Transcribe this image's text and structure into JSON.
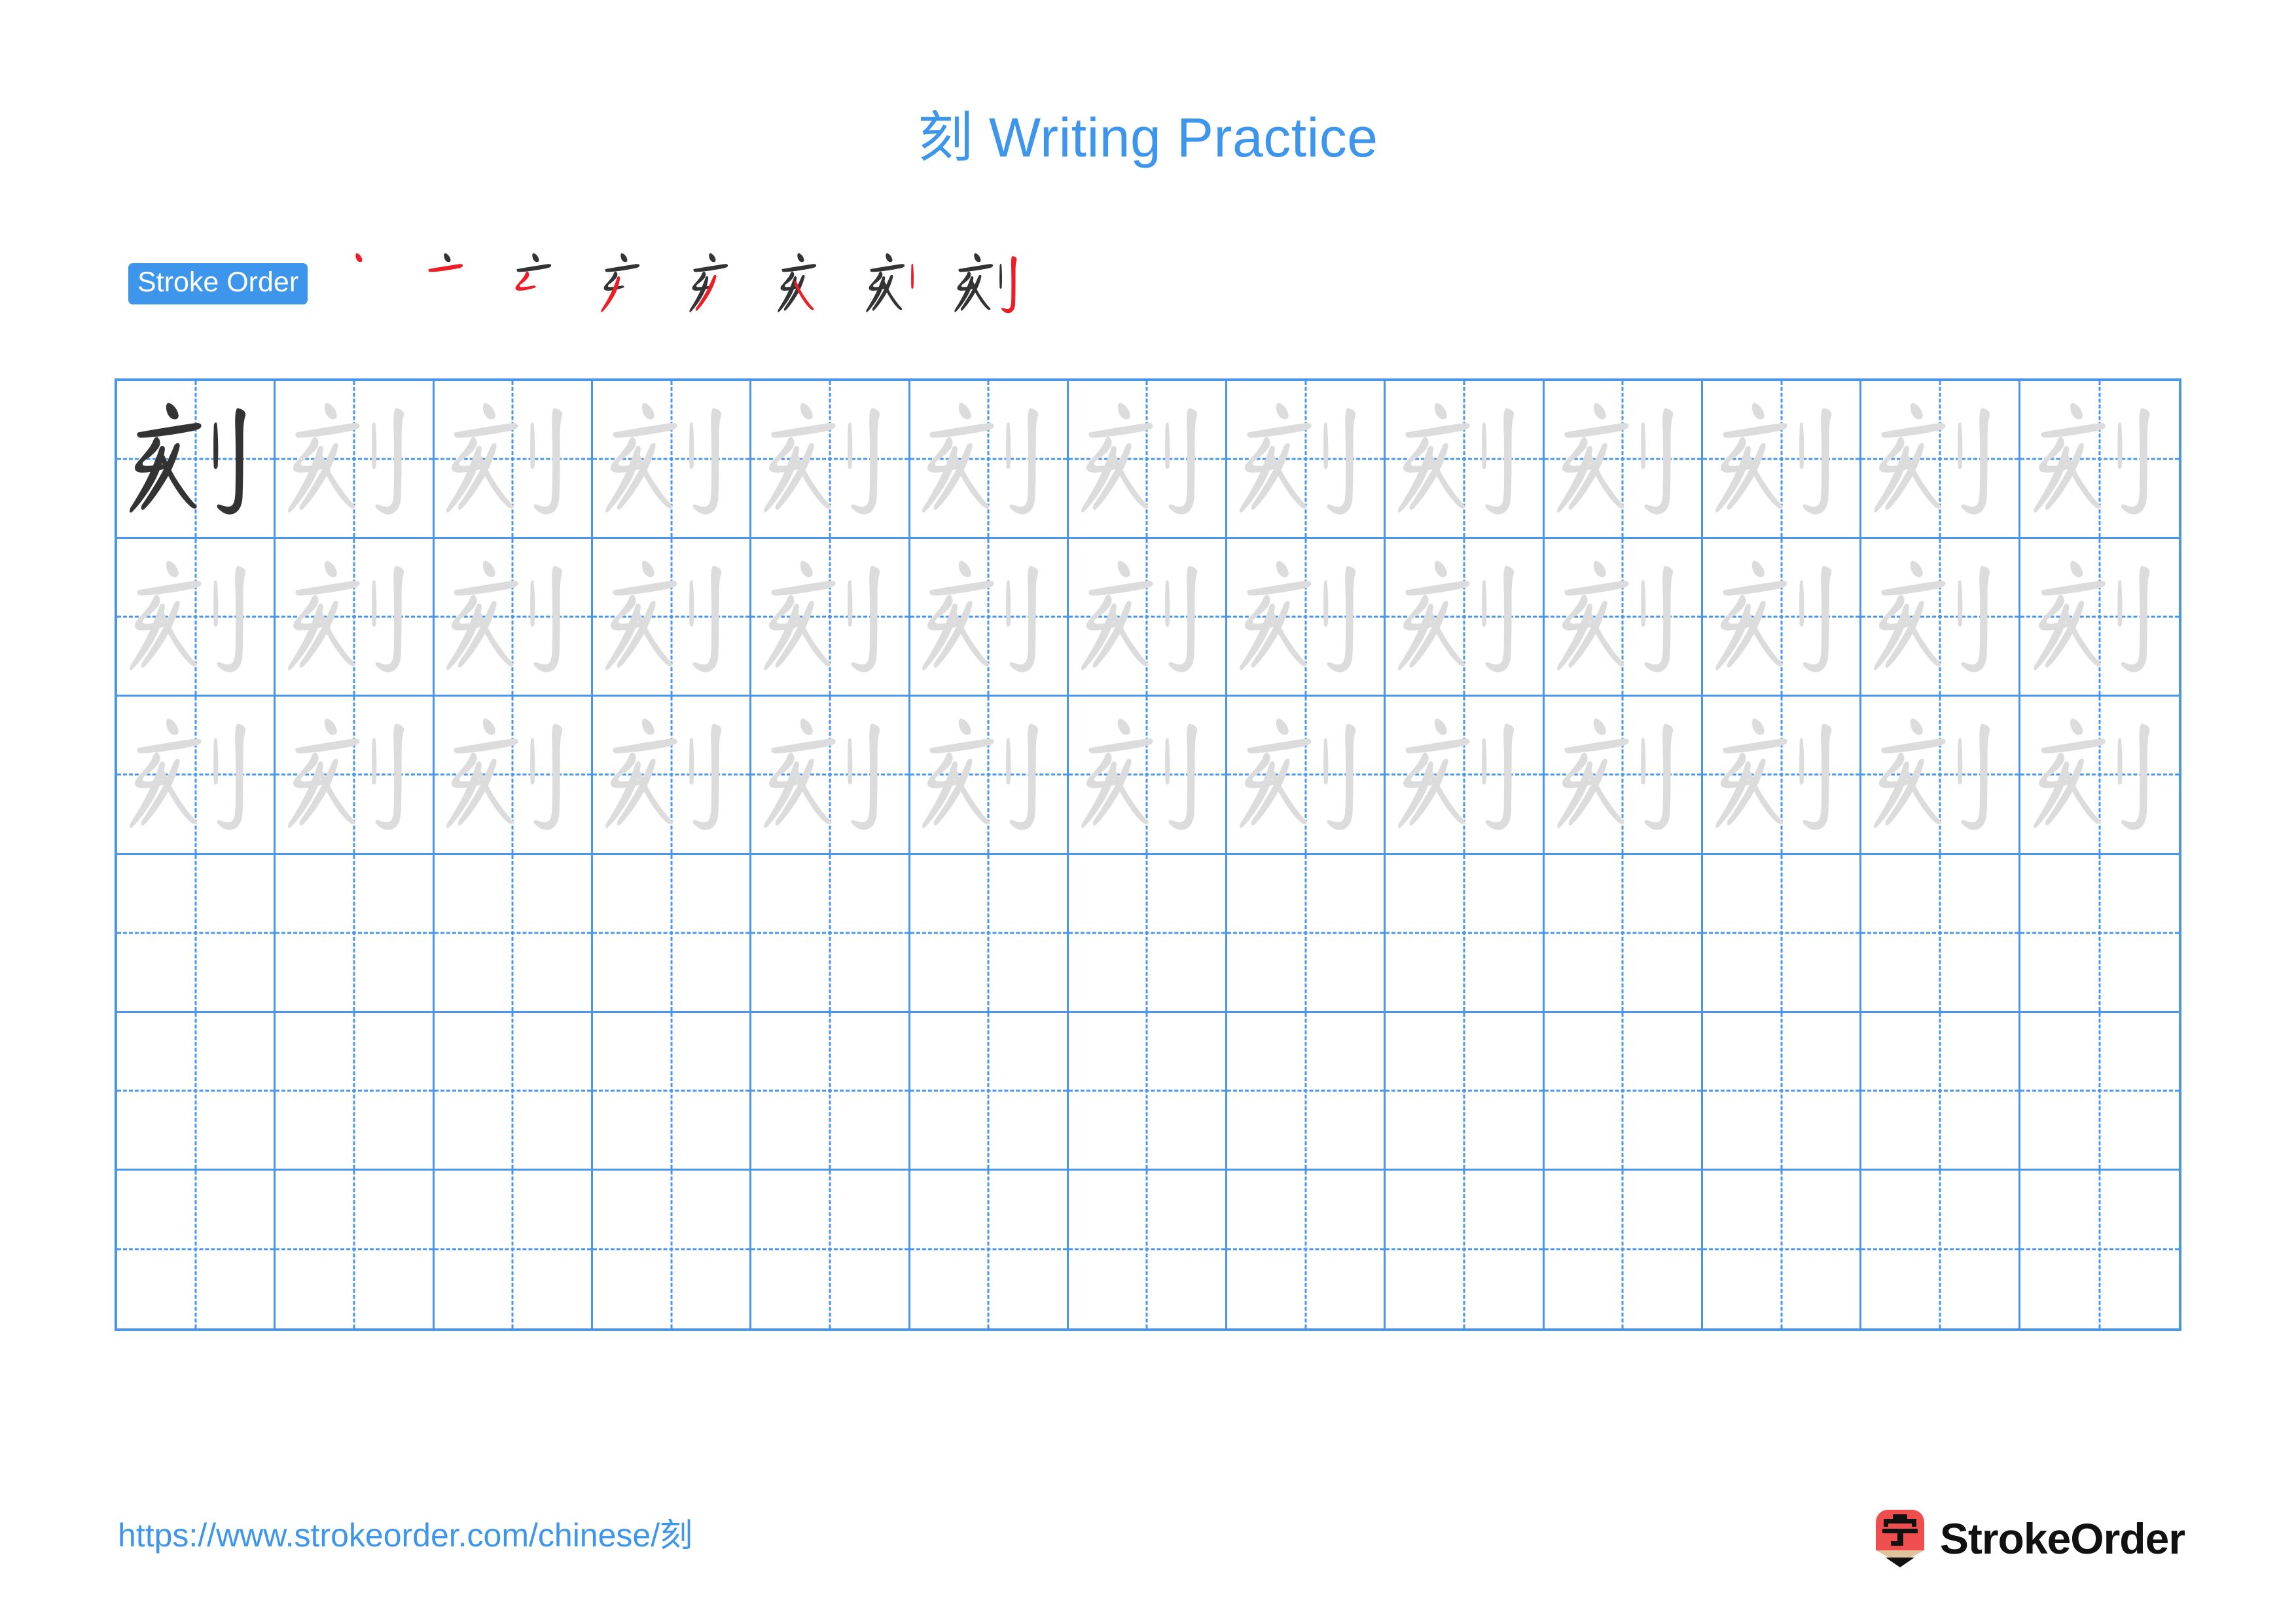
{
  "page": {
    "character": "刻",
    "title": "刻 Writing Practice",
    "title_color": "#3d96ec",
    "background": "#ffffff"
  },
  "stroke_order": {
    "badge_label": "Stroke Order",
    "badge_background": "#3d96ec",
    "badge_text_color": "#ffffff",
    "new_stroke_color": "#ee1c25",
    "prior_stroke_color": "#333333",
    "total_strokes": 8,
    "steps": [
      {
        "index": 1,
        "cumulative_glyph": "丶",
        "new_stroke_name": "dian"
      },
      {
        "index": 2,
        "cumulative_glyph": "亠",
        "new_stroke_name": "heng"
      },
      {
        "index": 3,
        "cumulative_glyph": "亡",
        "new_stroke_name": "hengzhe"
      },
      {
        "index": 4,
        "cumulative_glyph": "亥",
        "new_stroke_name": "pie"
      },
      {
        "index": 5,
        "cumulative_glyph": "亥",
        "new_stroke_name": "pie"
      },
      {
        "index": 6,
        "cumulative_glyph": "亥",
        "new_stroke_name": "na"
      },
      {
        "index": 7,
        "cumulative_glyph": "刻",
        "new_stroke_name": "shu"
      },
      {
        "index": 8,
        "cumulative_glyph": "刻",
        "new_stroke_name": "shugou"
      }
    ]
  },
  "grid": {
    "columns": 13,
    "rows": 6,
    "line_color": "#4a96ec",
    "guide_color": "#4a96ec",
    "model_glyph_color": "#333333",
    "trace_glyph_color": "#dcdcdc",
    "row_fill": [
      "model-then-trace",
      "trace",
      "trace",
      "empty",
      "empty",
      "empty"
    ]
  },
  "footer": {
    "url": "https://www.strokeorder.com/chinese/刻",
    "url_color": "#3d96ec",
    "brand_name": "StrokeOrder",
    "brand_glyph": "字",
    "brand_body_color": "#ef4e4e",
    "brand_wood_color": "#e0c39c",
    "brand_tip_color": "#111111"
  }
}
